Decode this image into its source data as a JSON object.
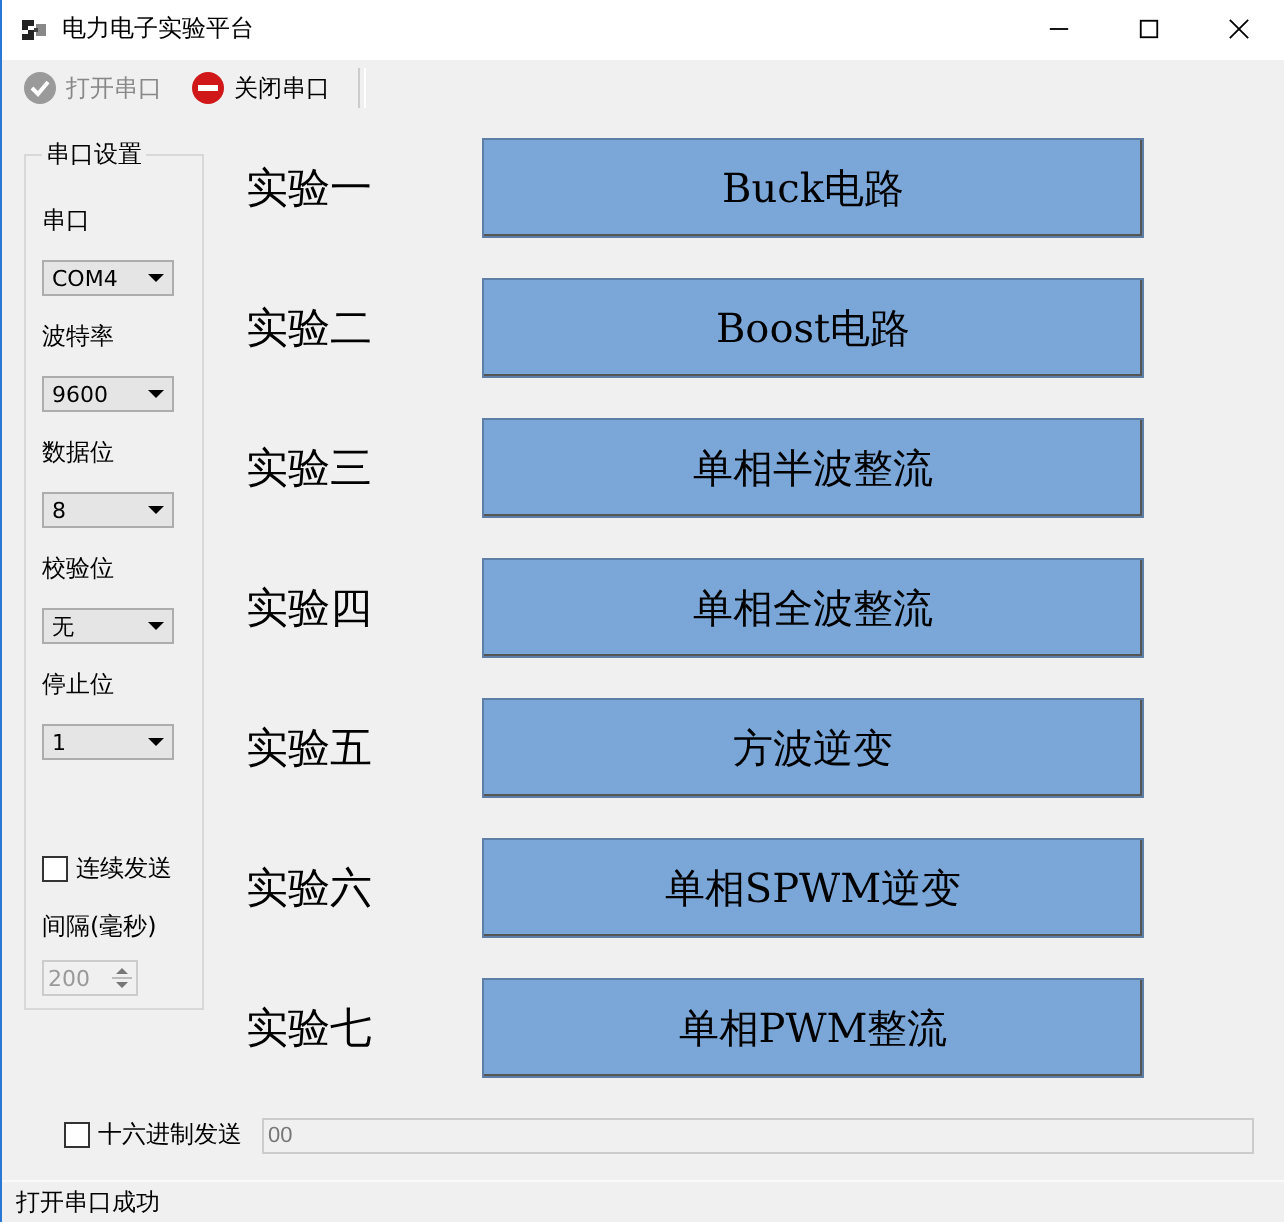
{
  "window": {
    "title": "电力电子实验平台"
  },
  "toolbar": [
    {
      "label": "打开串口",
      "kind": "open",
      "disabled": true
    },
    {
      "label": "关闭串口",
      "kind": "close",
      "disabled": false
    }
  ],
  "serial_settings": {
    "title": "串口设置",
    "items": [
      {
        "kind": "combo",
        "label": "串口",
        "value": "COM4"
      },
      {
        "kind": "combo",
        "label": "波特率",
        "value": "9600"
      },
      {
        "kind": "combo",
        "label": "数据位",
        "value": "8"
      },
      {
        "kind": "combo",
        "label": "校验位",
        "value": "无"
      },
      {
        "kind": "combo",
        "label": "停止位",
        "value": "1"
      },
      {
        "kind": "checkbox",
        "label": "连续发送",
        "checked": false
      },
      {
        "kind": "spin",
        "label": "间隔(毫秒)",
        "value": "200",
        "disabled": true
      }
    ]
  },
  "experiments": [
    {
      "label": "实验一",
      "button": "Buck电路"
    },
    {
      "label": "实验二",
      "button": "Boost电路"
    },
    {
      "label": "实验三",
      "button": "单相半波整流"
    },
    {
      "label": "实验四",
      "button": "单相全波整流"
    },
    {
      "label": "实验五",
      "button": "方波逆变"
    },
    {
      "label": "实验六",
      "button": "单相SPWM逆变"
    },
    {
      "label": "实验七",
      "button": "单相PWM整流"
    }
  ],
  "send": {
    "hex_label": "十六进制发送",
    "hex_checked": false,
    "value": "00"
  },
  "status_bar": "打开串口成功"
}
